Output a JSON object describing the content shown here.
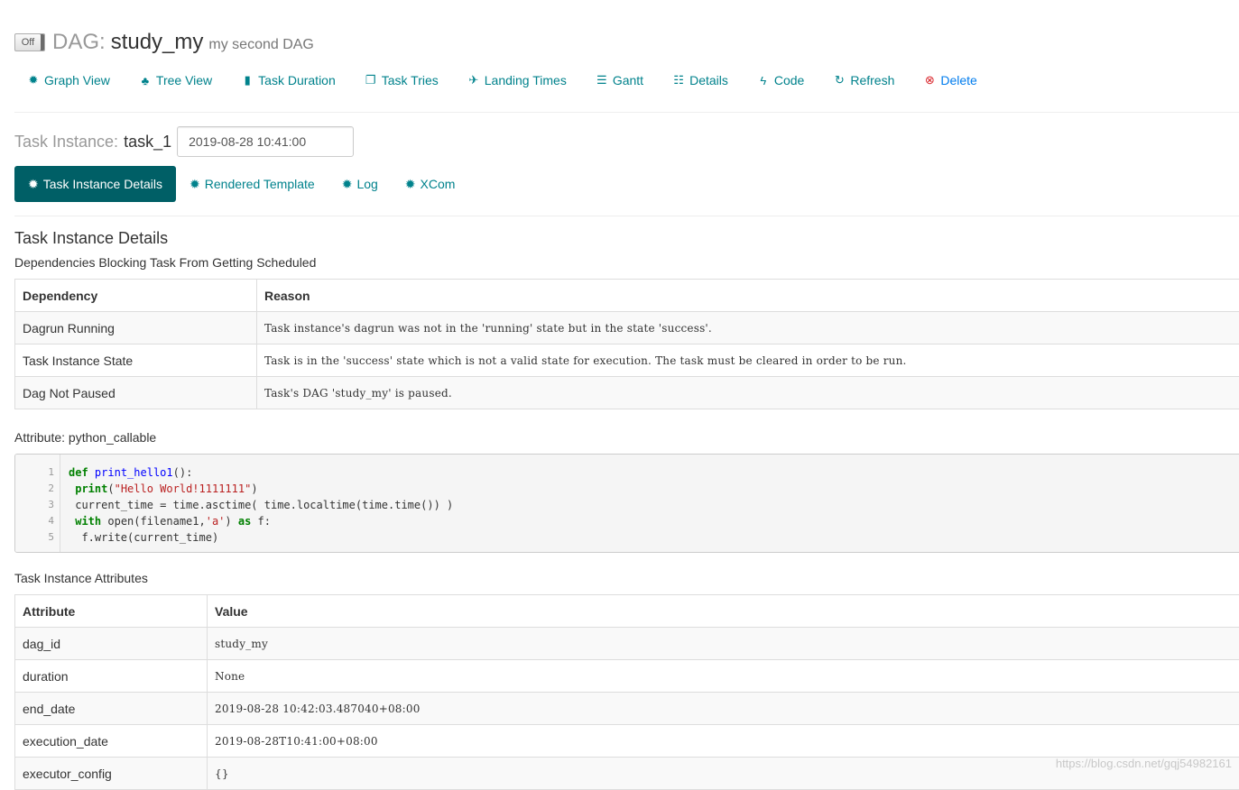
{
  "header": {
    "toggle_label": "Off",
    "dag_label": "DAG:",
    "dag_name": "study_my",
    "dag_description": "my second DAG"
  },
  "nav": [
    {
      "label": "Graph View",
      "icon": "asterisk-icon",
      "glyph": "✹"
    },
    {
      "label": "Tree View",
      "icon": "tree-icon",
      "glyph": "♣"
    },
    {
      "label": "Task Duration",
      "icon": "stats-icon",
      "glyph": "▮"
    },
    {
      "label": "Task Tries",
      "icon": "duplicate-icon",
      "glyph": "❐"
    },
    {
      "label": "Landing Times",
      "icon": "plane-icon",
      "glyph": "✈"
    },
    {
      "label": "Gantt",
      "icon": "align-left-icon",
      "glyph": "☰"
    },
    {
      "label": "Details",
      "icon": "list-icon",
      "glyph": "☷"
    },
    {
      "label": "Code",
      "icon": "flash-icon",
      "glyph": "ϟ"
    },
    {
      "label": "Refresh",
      "icon": "refresh-icon",
      "glyph": "↻"
    },
    {
      "label": "Delete",
      "icon": "remove-circle-icon",
      "glyph": "⊗"
    }
  ],
  "task_instance": {
    "label": "Task Instance:",
    "name": "task_1",
    "execution_date": "2019-08-28 10:41:00"
  },
  "tabs": [
    {
      "label": "Task Instance Details",
      "active": true
    },
    {
      "label": "Rendered Template",
      "active": false
    },
    {
      "label": "Log",
      "active": false
    },
    {
      "label": "XCom",
      "active": false
    }
  ],
  "details": {
    "heading": "Task Instance Details",
    "dependencies_caption": "Dependencies Blocking Task From Getting Scheduled",
    "dependency_headers": [
      "Dependency",
      "Reason"
    ],
    "dependencies": [
      {
        "dependency": "Dagrun Running",
        "reason": "Task instance's dagrun was not in the 'running' state but in the state 'success'."
      },
      {
        "dependency": "Task Instance State",
        "reason": "Task is in the 'success' state which is not a valid state for execution. The task must be cleared in order to be run."
      },
      {
        "dependency": "Dag Not Paused",
        "reason": "Task's DAG 'study_my' is paused."
      }
    ],
    "attribute_caption": "Attribute: python_callable",
    "code_lines": [
      "def print_hello1():",
      " print(\"Hello World!1111111\")",
      " current_time = time.asctime( time.localtime(time.time()) )",
      " with open(filename1,'a') as f:",
      "  f.write(current_time)"
    ],
    "attributes_caption": "Task Instance Attributes",
    "attribute_headers": [
      "Attribute",
      "Value"
    ],
    "attributes": [
      {
        "attribute": "dag_id",
        "value": "study_my"
      },
      {
        "attribute": "duration",
        "value": "None"
      },
      {
        "attribute": "end_date",
        "value": "2019-08-28 10:42:03.487040+08:00"
      },
      {
        "attribute": "execution_date",
        "value": "2019-08-28T10:41:00+08:00"
      },
      {
        "attribute": "executor_config",
        "value": "{}"
      }
    ]
  },
  "watermark": "https://blog.csdn.net/gqj54982161",
  "colors": {
    "accent": "#00828c",
    "active_tab": "#005f66",
    "danger": "#d9242a"
  }
}
